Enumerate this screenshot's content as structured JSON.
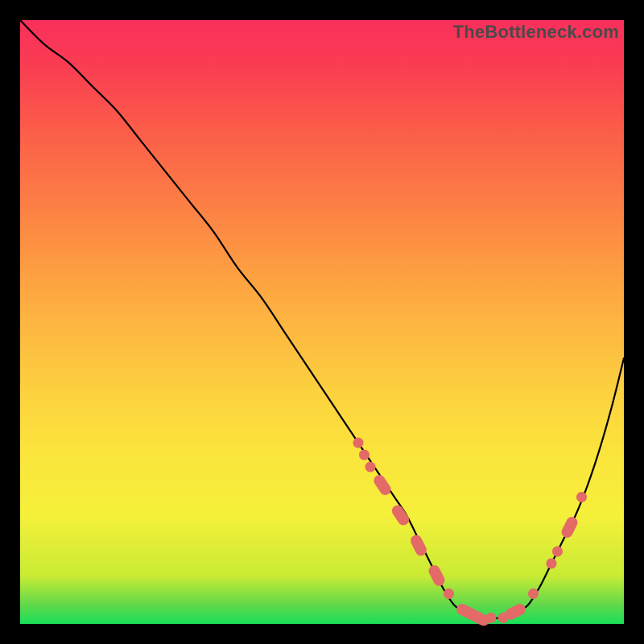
{
  "watermark": "TheBottleneck.com",
  "colors": {
    "curve_stroke": "#000000",
    "marker_fill": "#e36a66",
    "marker_stroke": "#e36a66"
  },
  "chart_data": {
    "type": "line",
    "title": "",
    "xlabel": "",
    "ylabel": "",
    "xlim": [
      0,
      100
    ],
    "ylim": [
      0,
      100
    ],
    "grid": false,
    "legend": false,
    "note": "Bottleneck-style V-curve. x is the normalized sweep axis (0–100, left→right). y is bottleneck percentage (0=best/green at bottom, 100=worst/red at top). Values are read off the curve by vertical pixel position relative to the gradient.",
    "series": [
      {
        "name": "bottleneck-curve",
        "x": [
          0,
          4,
          8,
          12,
          16,
          20,
          24,
          28,
          32,
          36,
          40,
          44,
          48,
          52,
          56,
          58,
          60,
          62,
          64,
          66,
          68,
          70,
          72,
          74,
          76,
          78,
          80,
          82,
          84,
          86,
          88,
          90,
          92,
          94,
          96,
          98,
          100
        ],
        "y": [
          100,
          96,
          93,
          89,
          85,
          80,
          75,
          70,
          65,
          59,
          54,
          48,
          42,
          36,
          30,
          27,
          24,
          21,
          18,
          14,
          10,
          6,
          3,
          2,
          1,
          1,
          1,
          2,
          3,
          6,
          10,
          14,
          18,
          23,
          29,
          36,
          44
        ]
      },
      {
        "name": "highlight-markers",
        "note": "Pink capsule/dot markers drawn along the curve near the trough and on the ascending right shoulder.",
        "points": [
          {
            "x": 56,
            "y": 30,
            "shape": "dot"
          },
          {
            "x": 57,
            "y": 28,
            "shape": "dot"
          },
          {
            "x": 58,
            "y": 26,
            "shape": "dot"
          },
          {
            "x": 60,
            "y": 23,
            "shape": "capsule"
          },
          {
            "x": 63,
            "y": 18,
            "shape": "capsule"
          },
          {
            "x": 66,
            "y": 13,
            "shape": "capsule"
          },
          {
            "x": 69,
            "y": 8,
            "shape": "capsule"
          },
          {
            "x": 71,
            "y": 5,
            "shape": "dot"
          },
          {
            "x": 74,
            "y": 2,
            "shape": "capsule"
          },
          {
            "x": 76,
            "y": 1,
            "shape": "capsule"
          },
          {
            "x": 78,
            "y": 1,
            "shape": "dot"
          },
          {
            "x": 80,
            "y": 1,
            "shape": "dot"
          },
          {
            "x": 82,
            "y": 2,
            "shape": "capsule"
          },
          {
            "x": 85,
            "y": 5,
            "shape": "dot"
          },
          {
            "x": 88,
            "y": 10,
            "shape": "dot"
          },
          {
            "x": 89,
            "y": 12,
            "shape": "dot"
          },
          {
            "x": 91,
            "y": 16,
            "shape": "capsule"
          },
          {
            "x": 93,
            "y": 21,
            "shape": "dot"
          }
        ]
      }
    ]
  }
}
